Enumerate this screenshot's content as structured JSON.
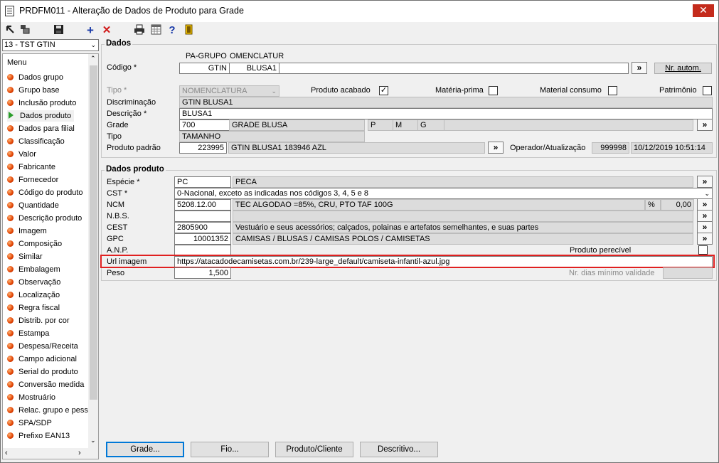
{
  "window": {
    "title": "PRDFM011 - Alteração de Dados de Produto para Grade",
    "close": "✕"
  },
  "toolbar": {
    "add": "+",
    "delete": "✕",
    "help": "?"
  },
  "company_combo": {
    "value": "13 - TST GTIN"
  },
  "menu": {
    "header": "Menu",
    "items": [
      "Dados grupo",
      "Grupo base",
      "Inclusão produto",
      "Dados produto",
      "Dados para filial",
      "Classificação",
      "Valor",
      "Fabricante",
      "Fornecedor",
      "Código do produto",
      "Quantidade",
      "Descrição produto",
      "Imagem",
      "Composição",
      "Similar",
      "Embalagem",
      "Observação",
      "Localização",
      "Regra fiscal",
      "Distrib. por cor",
      "Estampa",
      "Despesa/Receita",
      "Campo adicional",
      "Serial do produto",
      "Conversão medida",
      "Mostruário",
      "Relac. grupo e pess",
      "SPA/SDP",
      "Prefixo EAN13"
    ],
    "selected_index": 3
  },
  "dados": {
    "title": "Dados",
    "col_header_1": "PA-GRUPO",
    "col_header_2": "OMENCLATUR",
    "codigo_label": "Código *",
    "codigo_part1": "GTIN",
    "codigo_part2": "BLUSA1",
    "codigo_part3": "",
    "btn_more": "»",
    "nr_autom": "Nr. autom.",
    "tipo_label": "Tipo *",
    "tipo_value": "NOMENCLATURA",
    "produto_acabado": "Produto acabado",
    "produto_acabado_checked": "✓",
    "materia_prima": "Matéria-prima",
    "material_consumo": "Material consumo",
    "patrimonio": "Patrimônio",
    "discriminacao_label": "Discriminação",
    "discriminacao_value": "GTIN BLUSA1",
    "descricao_label": "Descrição *",
    "descricao_value": "BLUSA1",
    "grade_label": "Grade",
    "grade_code": "700",
    "grade_name": "GRADE BLUSA",
    "grade_sizes": [
      "P",
      "M",
      "G"
    ],
    "tipo2_label": "Tipo",
    "tipo2_value": "TAMANHO",
    "produto_padrao_label": "Produto padrão",
    "produto_padrao_code": "223995",
    "produto_padrao_name": "GTIN BLUSA1 183946 AZL",
    "operador_label": "Operador/Atualização",
    "operador_value": "999998",
    "atualizacao_value": "10/12/2019 10:51:14"
  },
  "dados_produto": {
    "title": "Dados produto",
    "especie_label": "Espécie *",
    "especie_code": "PC",
    "especie_name": "PECA",
    "cst_label": "CST *",
    "cst_value": "0-Nacional, exceto as indicadas nos códigos 3, 4, 5 e 8",
    "ncm_label": "NCM",
    "ncm_code": "5208.12.00",
    "ncm_desc": "TEC ALGODAO  =85%, CRU, PTO TAF 100G",
    "ncm_pct_label": "%",
    "ncm_pct_value": "0,00",
    "nbs_label": "N.B.S.",
    "cest_label": "CEST",
    "cest_code": "2805900",
    "cest_desc": "Vestuário e seus acessórios; calçados, polainas e artefatos semelhantes, e suas partes",
    "gpc_label": "GPC",
    "gpc_code": "10001352",
    "gpc_desc": "CAMISAS / BLUSAS / CAMISAS POLOS / CAMISETAS",
    "anp_label": "A.N.P.",
    "perecivel_label": "Produto perecível",
    "url_label": "Url imagem",
    "url_value": "https://atacadodecamisetas.com.br/239-large_default/camiseta-infantil-azul.jpg",
    "peso_label": "Peso",
    "peso_value": "1,500",
    "validade_label": "Nr. dias mínimo validade"
  },
  "bottom_buttons": {
    "grade": "Grade...",
    "fio": "Fio...",
    "produto_cliente": "Produto/Cliente",
    "descritivo": "Descritivo..."
  }
}
